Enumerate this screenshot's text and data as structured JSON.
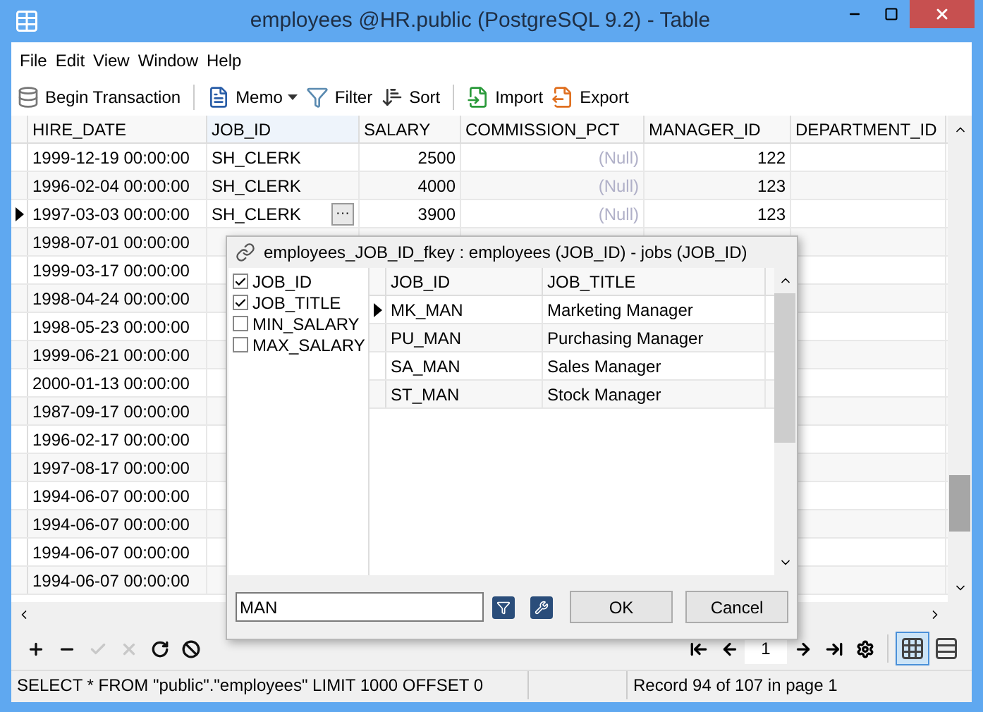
{
  "window": {
    "title": "employees @HR.public (PostgreSQL 9.2) - Table"
  },
  "menu": [
    "File",
    "Edit",
    "View",
    "Window",
    "Help"
  ],
  "toolbar": [
    {
      "kind": "transaction",
      "label": "Begin Transaction"
    },
    {
      "kind": "memo",
      "label": "Memo"
    },
    {
      "kind": "filter",
      "label": "Filter"
    },
    {
      "kind": "sort",
      "label": "Sort"
    },
    {
      "kind": "import",
      "label": "Import"
    },
    {
      "kind": "export",
      "label": "Export"
    }
  ],
  "table": {
    "columns": [
      "HIRE_DATE",
      "JOB_ID",
      "SALARY",
      "COMMISSION_PCT",
      "MANAGER_ID",
      "DEPARTMENT_ID"
    ],
    "cell_button": "···",
    "rows": [
      {
        "cells": [
          "1999-12-19 00:00:00",
          "SH_CLERK",
          "2500",
          {
            "text": "(Null)",
            "kind": "null"
          },
          "122"
        ],
        "current": false
      },
      {
        "cells": [
          "1996-02-04 00:00:00",
          "SH_CLERK",
          "4000",
          {
            "text": "(Null)",
            "kind": "null"
          },
          "123"
        ],
        "current": false
      },
      {
        "cells": [
          "1997-03-03 00:00:00",
          "SH_CLERK",
          "3900",
          {
            "text": "(Null)",
            "kind": "null"
          },
          "123"
        ],
        "current": true
      },
      {
        "cells": [
          "1998-07-01 00:00:00"
        ],
        "current": false
      },
      {
        "cells": [
          "1999-03-17 00:00:00"
        ],
        "current": false
      },
      {
        "cells": [
          "1998-04-24 00:00:00"
        ],
        "current": false
      },
      {
        "cells": [
          "1998-05-23 00:00:00"
        ],
        "current": false
      },
      {
        "cells": [
          "1999-06-21 00:00:00"
        ],
        "current": false
      },
      {
        "cells": [
          "2000-01-13 00:00:00"
        ],
        "current": false
      },
      {
        "cells": [
          "1987-09-17 00:00:00"
        ],
        "current": false
      },
      {
        "cells": [
          "1996-02-17 00:00:00"
        ],
        "current": false
      },
      {
        "cells": [
          "1997-08-17 00:00:00"
        ],
        "current": false
      },
      {
        "cells": [
          "1994-06-07 00:00:00"
        ],
        "current": false
      },
      {
        "cells": [
          "1994-06-07 00:00:00"
        ],
        "current": false
      },
      {
        "cells": [
          "1994-06-07 00:00:00"
        ],
        "current": false
      },
      {
        "cells": [
          "1994-06-07 00:00:00"
        ],
        "current": false
      }
    ]
  },
  "lookup_popup": {
    "title": "employees_JOB_ID_fkey : employees (JOB_ID) - jobs (JOB_ID)",
    "fields": [
      {
        "label": "JOB_ID",
        "checked": true
      },
      {
        "label": "JOB_TITLE",
        "checked": true
      },
      {
        "label": "MIN_SALARY",
        "checked": false
      },
      {
        "label": "MAX_SALARY",
        "checked": false
      }
    ],
    "columns": [
      "JOB_ID",
      "JOB_TITLE"
    ],
    "rows": [
      {
        "cells": [
          "MK_MAN",
          "Marketing Manager"
        ],
        "current": true
      },
      {
        "cells": [
          "PU_MAN",
          "Purchasing Manager"
        ],
        "current": false
      },
      {
        "cells": [
          "SA_MAN",
          "Sales Manager"
        ],
        "current": false
      },
      {
        "cells": [
          "ST_MAN",
          "Stock Manager"
        ],
        "current": false
      }
    ],
    "search": {
      "value": "MAN"
    },
    "buttons": [
      "OK",
      "Cancel"
    ]
  },
  "record_actions": [
    {
      "kind": "add",
      "disabled": false
    },
    {
      "kind": "delete",
      "disabled": false
    },
    {
      "kind": "apply",
      "disabled": true
    },
    {
      "kind": "discard",
      "disabled": true
    },
    {
      "kind": "refresh",
      "disabled": false
    },
    {
      "kind": "stop",
      "disabled": false
    }
  ],
  "pager": {
    "page": "1"
  },
  "view_modes": [
    {
      "kind": "grid",
      "selected": true
    },
    {
      "kind": "form",
      "selected": false
    }
  ],
  "status_bar": {
    "query": "SELECT * FROM \"public\".\"employees\" LIMIT 1000 OFFSET 0",
    "record": "Record 94 of 107 in page 1"
  }
}
